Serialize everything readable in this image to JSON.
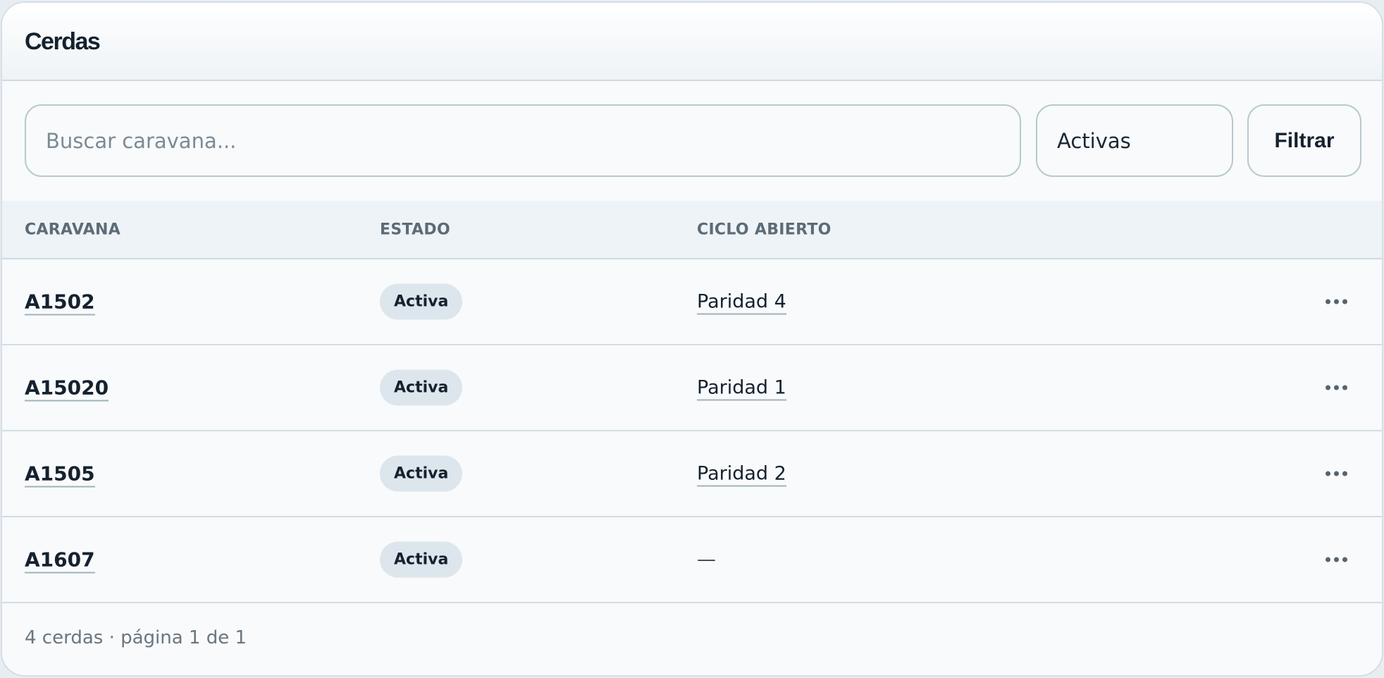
{
  "header": {
    "title": "Cerdas"
  },
  "toolbar": {
    "search_placeholder": "Buscar caravana...",
    "search_value": "",
    "status_selected": "Activas",
    "filter_label": "Filtrar"
  },
  "table": {
    "columns": [
      "CARAVANA",
      "ESTADO",
      "CICLO ABIERTO"
    ],
    "rows": [
      {
        "caravana": "A1502",
        "estado": "Activa",
        "ciclo": "Paridad 4"
      },
      {
        "caravana": "A15020",
        "estado": "Activa",
        "ciclo": "Paridad 1"
      },
      {
        "caravana": "A1505",
        "estado": "Activa",
        "ciclo": "Paridad 2"
      },
      {
        "caravana": "A1607",
        "estado": "Activa",
        "ciclo": "—"
      }
    ]
  },
  "footer": {
    "summary": "4 cerdas · página 1 de 1"
  },
  "icons": {
    "row_menu": "more-horizontal-icon"
  },
  "colors": {
    "text": "#15212e",
    "badge_bg": "#dde6ed",
    "border": "#b8c9cf"
  }
}
